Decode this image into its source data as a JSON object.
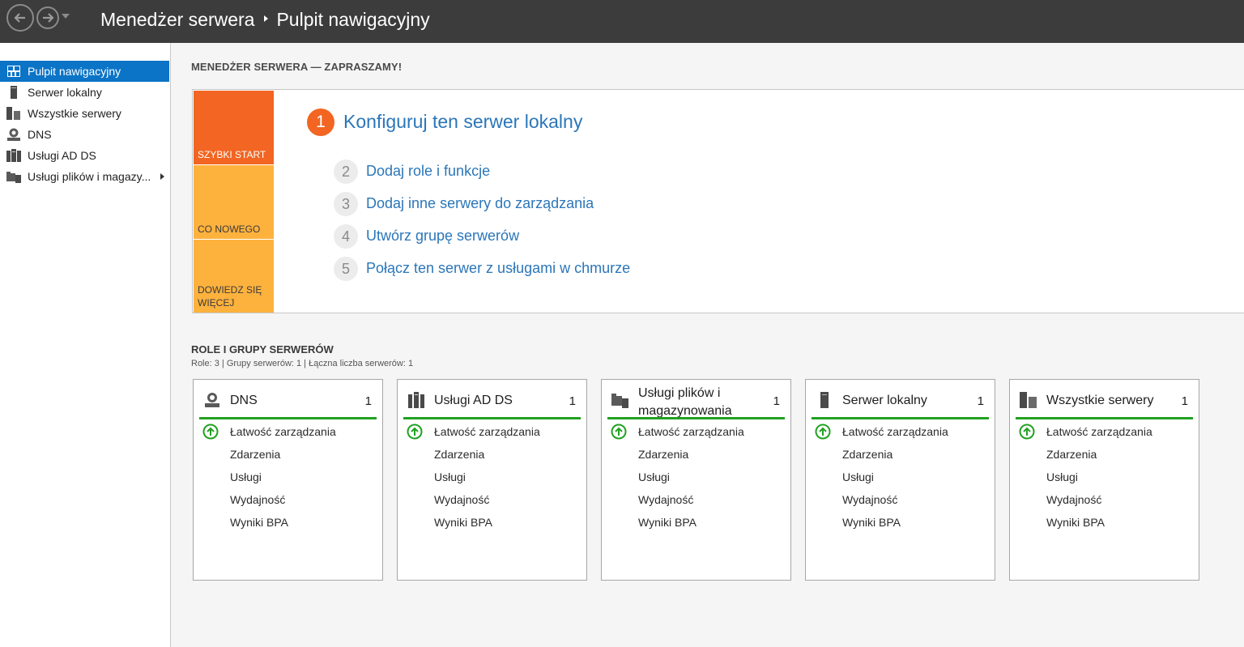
{
  "titlebar": {
    "app": "Menedżer serwera",
    "page": "Pulpit nawigacyjny"
  },
  "sidebar": {
    "items": [
      {
        "label": "Pulpit nawigacyjny",
        "icon": "dashboard-icon",
        "active": true
      },
      {
        "label": "Serwer lokalny",
        "icon": "server-icon"
      },
      {
        "label": "Wszystkie serwery",
        "icon": "servers-icon"
      },
      {
        "label": "DNS",
        "icon": "dns-icon"
      },
      {
        "label": "Usługi AD DS",
        "icon": "adds-icon"
      },
      {
        "label": "Usługi plików i magazy...",
        "icon": "file-storage-icon",
        "expandable": true
      }
    ]
  },
  "welcome": {
    "heading": "MENEDŻER SERWERA — ZAPRASZAMY!",
    "tiles": {
      "quick_start": "SZYBKI START",
      "whats_new": "CO NOWEGO",
      "learn_more": "DOWIEDZ SIĘ WIĘCEJ"
    },
    "steps": [
      {
        "num": "1",
        "label": "Konfiguruj ten serwer lokalny"
      },
      {
        "num": "2",
        "label": "Dodaj role i funkcje"
      },
      {
        "num": "3",
        "label": "Dodaj inne serwery do zarządzania"
      },
      {
        "num": "4",
        "label": "Utwórz grupę serwerów"
      },
      {
        "num": "5",
        "label": "Połącz ten serwer z usługami w chmurze"
      }
    ]
  },
  "roles": {
    "heading": "ROLE I GRUPY SERWERÓW",
    "summary": "Role: 3 | Grupy serwerów: 1 | Łączna liczba serwerów: 1",
    "cards": [
      {
        "title": "DNS",
        "count": "1",
        "icon": "dns-icon",
        "rows": [
          "Łatwość zarządzania",
          "Zdarzenia",
          "Usługi",
          "Wydajność",
          "Wyniki BPA"
        ]
      },
      {
        "title": "Usługi AD DS",
        "count": "1",
        "icon": "adds-icon",
        "rows": [
          "Łatwość zarządzania",
          "Zdarzenia",
          "Usługi",
          "Wydajność",
          "Wyniki BPA"
        ]
      },
      {
        "title": "Usługi plików i magazynowania",
        "count": "1",
        "icon": "file-storage-icon",
        "rows": [
          "Łatwość zarządzania",
          "Zdarzenia",
          "Usługi",
          "Wydajność",
          "Wyniki BPA"
        ]
      },
      {
        "title": "Serwer lokalny",
        "count": "1",
        "icon": "server-icon",
        "rows": [
          "Łatwość zarządzania",
          "Zdarzenia",
          "Usługi",
          "Wydajność",
          "Wyniki BPA"
        ]
      },
      {
        "title": "Wszystkie serwery",
        "count": "1",
        "icon": "servers-icon",
        "rows": [
          "Łatwość zarządzania",
          "Zdarzenia",
          "Usługi",
          "Wydajność",
          "Wyniki BPA"
        ]
      }
    ]
  },
  "colors": {
    "titlebar": "#3c3c3c",
    "accent_blue": "#0b74c6",
    "link_blue": "#2b76b9",
    "quick_start_orange": "#f26522",
    "tile_amber": "#feb23e",
    "status_green": "#21a121"
  }
}
